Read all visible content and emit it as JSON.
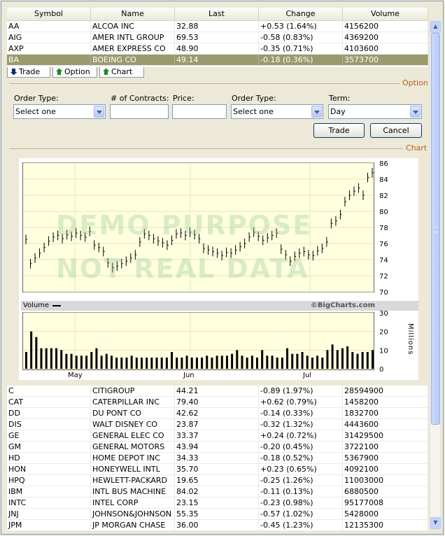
{
  "columns": [
    "Symbol",
    "Name",
    "Last",
    "Change",
    "Volume"
  ],
  "top_rows": [
    {
      "symbol": "AA",
      "name": "ALCOA INC",
      "last": "32.88",
      "change": "+0.53 (1.64%)",
      "volume": "4156200"
    },
    {
      "symbol": "AIG",
      "name": "AMER INTL GROUP",
      "last": "69.53",
      "change": "-0.58 (0.83%)",
      "volume": "4369200"
    },
    {
      "symbol": "AXP",
      "name": "AMER EXPRESS CO",
      "last": "48.90",
      "change": "-0.35 (0.71%)",
      "volume": "4103600"
    },
    {
      "symbol": "BA",
      "name": "BOEING CO",
      "last": "49.14",
      "change": "-0.18 (0.36%)",
      "volume": "3573700"
    }
  ],
  "tabs": [
    {
      "label": "Trade",
      "icon": "arrow-down-icon"
    },
    {
      "label": "Option",
      "icon": "arrow-up-icon"
    },
    {
      "label": "Chart",
      "icon": "arrow-up-icon"
    }
  ],
  "option_section": {
    "title": "Option",
    "order_type_label": "Order Type:",
    "order_type_value": "Select one",
    "contracts_label": "# of Contracts:",
    "contracts_value": "",
    "price_label": "Price:",
    "price_value": "",
    "order_type2_label": "Order Type:",
    "order_type2_value": "Select one",
    "term_label": "Term:",
    "term_value": "Day",
    "trade_button": "Trade",
    "cancel_button": "Cancel"
  },
  "chart_section": {
    "title": "Chart",
    "watermark_line1": "DEMO PURPOSE",
    "watermark_line2": "NOT REAL DATA",
    "volume_label": "Volume",
    "source": "©BigCharts.com",
    "vol_unit": "Millions"
  },
  "chart_data": {
    "type": "bar",
    "price_ylim": [
      70,
      86
    ],
    "price_ticks": [
      "86",
      "84",
      "82",
      "80",
      "78",
      "76",
      "74",
      "72",
      "70"
    ],
    "volume_ylim": [
      0,
      30
    ],
    "volume_ticks": [
      "30",
      "20",
      "10",
      "0"
    ],
    "x_tick_labels": [
      "May",
      "Jun",
      "Jul"
    ],
    "price_series": {
      "name": "",
      "values": [
        76.5,
        73.5,
        74.2,
        74.8,
        75.5,
        76.3,
        76.8,
        77.0,
        76.6,
        77.1,
        76.9,
        77.3,
        77.0,
        76.8,
        77.5,
        75.8,
        75.5,
        75.0,
        73.6,
        73.0,
        73.2,
        73.5,
        73.8,
        74.2,
        74.6,
        76.2,
        77.2,
        77.0,
        76.6,
        76.3,
        76.1,
        75.8,
        76.4,
        77.2,
        77.3,
        77.0,
        77.4,
        77.1,
        76.6,
        75.4,
        75.2,
        75.0,
        74.8,
        74.5,
        74.9,
        74.8,
        75.2,
        75.6,
        76.0,
        76.8,
        77.4,
        76.9,
        76.4,
        76.7,
        77.0,
        77.3,
        75.3,
        74.6,
        73.8,
        74.4,
        74.8,
        75.0,
        74.6,
        74.5,
        75.1,
        75.4,
        76.2,
        78.5,
        78.8,
        79.6,
        81.2,
        82.0,
        82.5,
        82.9,
        82.0,
        84.2,
        84.8
      ]
    },
    "volume_series": {
      "name": "",
      "values": [
        9,
        20,
        17,
        11,
        11,
        11,
        11,
        10,
        8,
        8,
        7,
        7,
        7,
        9,
        11,
        7,
        8,
        7,
        6,
        6,
        6,
        7,
        6,
        6,
        6,
        6,
        6,
        6,
        6,
        9,
        6,
        6,
        7,
        6,
        6,
        6,
        7,
        6,
        7,
        7,
        7,
        8,
        10,
        7,
        6,
        7,
        6,
        10,
        7,
        7,
        6,
        6,
        11,
        8,
        8,
        9,
        7,
        6,
        7,
        6,
        10,
        13,
        10,
        11,
        12,
        9,
        8,
        9,
        9,
        10
      ]
    }
  },
  "bottom_rows": [
    {
      "symbol": "C",
      "name": "CITIGROUP",
      "last": "44.21",
      "change": "-0.89 (1.97%)",
      "volume": "28594900"
    },
    {
      "symbol": "CAT",
      "name": "CATERPILLAR INC",
      "last": "79.40",
      "change": "+0.62 (0.79%)",
      "volume": "1458200"
    },
    {
      "symbol": "DD",
      "name": "DU PONT CO",
      "last": "42.62",
      "change": "-0.14 (0.33%)",
      "volume": "1832700"
    },
    {
      "symbol": "DIS",
      "name": " WALT DISNEY CO",
      "last": "23.87",
      "change": "-0.32 (1.32%)",
      "volume": "4443600"
    },
    {
      "symbol": "GE",
      "name": "GENERAL ELEC CO",
      "last": "33.37",
      "change": "+0.24 (0.72%)",
      "volume": "31429500"
    },
    {
      "symbol": "GM",
      "name": "GENERAL MOTORS",
      "last": "43.94",
      "change": "-0.20 (0.45%)",
      "volume": "3722100"
    },
    {
      "symbol": "HD",
      "name": "HOME DEPOT INC",
      "last": "34.33",
      "change": "-0.18 (0.52%)",
      "volume": "5367900"
    },
    {
      "symbol": "HON",
      "name": "HONEYWELL INTL",
      "last": "35.70",
      "change": "+0.23 (0.65%)",
      "volume": "4092100"
    },
    {
      "symbol": "HPQ",
      "name": "HEWLETT-PACKARD",
      "last": "19.65",
      "change": "-0.25 (1.26%)",
      "volume": "11003000"
    },
    {
      "symbol": "IBM",
      "name": "INTL BUS MACHINE",
      "last": "84.02",
      "change": "-0.11 (0.13%)",
      "volume": "6880500"
    },
    {
      "symbol": "INTC",
      "name": "INTEL CORP",
      "last": "23.15",
      "change": "-0.23 (0.98%)",
      "volume": "95177008"
    },
    {
      "symbol": "JNJ",
      "name": "JOHNSON&JOHNSON",
      "last": "55.35",
      "change": "-0.57 (1.02%)",
      "volume": "5428000"
    },
    {
      "symbol": "JPM",
      "name": "JP MORGAN CHASE",
      "last": "36.00",
      "change": "-0.45 (1.23%)",
      "volume": "12135300"
    }
  ]
}
